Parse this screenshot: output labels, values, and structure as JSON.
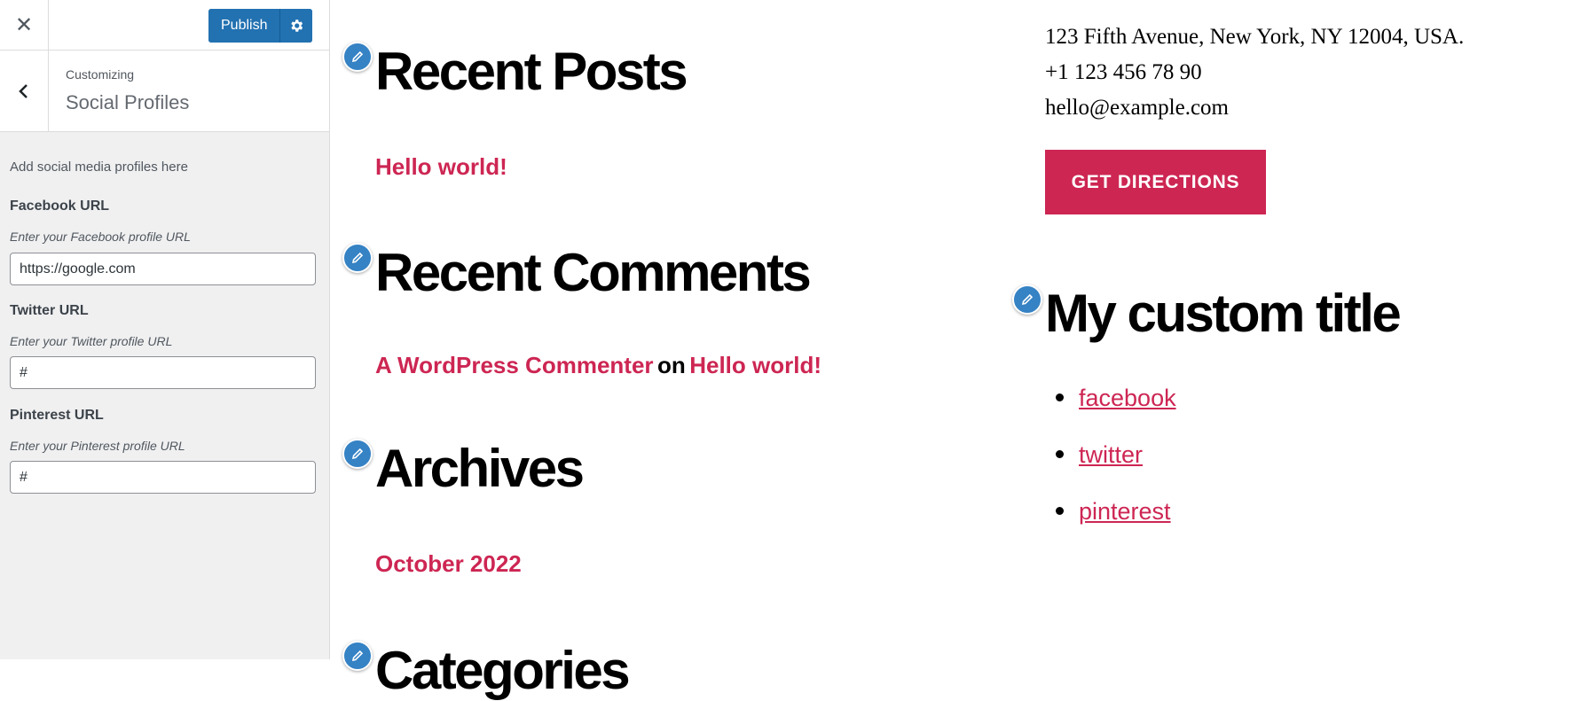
{
  "sidebar": {
    "close_icon": "close-icon",
    "publish_label": "Publish",
    "breadcrumb": "Customizing",
    "section_title": "Social Profiles",
    "description": "Add social media profiles here",
    "fields": [
      {
        "label": "Facebook URL",
        "hint": "Enter your Facebook profile URL",
        "value": "https://google.com"
      },
      {
        "label": "Twitter URL",
        "hint": "Enter your Twitter profile URL",
        "value": "#"
      },
      {
        "label": "Pinterest URL",
        "hint": "Enter your Pinterest profile URL",
        "value": "#"
      }
    ]
  },
  "preview": {
    "recent_posts": {
      "title": "Recent Posts",
      "post": "Hello world!"
    },
    "recent_comments": {
      "title": "Recent Comments",
      "author": "A WordPress Commenter",
      "on": "on",
      "post": "Hello world!"
    },
    "archives": {
      "title": "Archives",
      "month": "October 2022"
    },
    "categories": {
      "title": "Categories"
    },
    "contact": {
      "address": "123 Fifth Avenue, New York, NY 12004, USA.",
      "phone": "+1 123 456 78 90",
      "email": "hello@example.com",
      "button": "GET DIRECTIONS"
    },
    "custom": {
      "title": "My custom title",
      "links": [
        "facebook",
        "twitter",
        "pinterest"
      ]
    }
  },
  "colors": {
    "accent": "#cd2653",
    "primary_button": "#2271b1",
    "edit_shortcut": "#3582c4"
  }
}
